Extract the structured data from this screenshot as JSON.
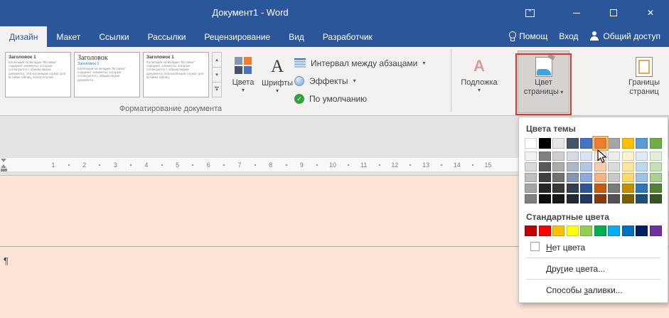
{
  "window": {
    "title": "Документ1 - Word"
  },
  "tabs": {
    "active_index": 0,
    "items": [
      {
        "label": "Дизайн"
      },
      {
        "label": "Макет"
      },
      {
        "label": "Ссылки"
      },
      {
        "label": "Рассылки"
      },
      {
        "label": "Рецензирование"
      },
      {
        "label": "Вид"
      },
      {
        "label": "Разработчик"
      }
    ],
    "help_label": "Помощ",
    "signin_label": "Вход",
    "share_label": "Общий доступ"
  },
  "ribbon": {
    "gallery_cards": [
      {
        "heading": "Заголовок 1",
        "body": "Коллекция на вкладке \"Вставка\" содержит элементы, которые согласуются с общим видом документа. Эти коллекции служат для вставки таблиц, колонтитулов."
      },
      {
        "heading": "Заголовок",
        "subheading": "Заголовок 1",
        "body": "Коллекция на вкладке \"Вставка\" содержит элементы, которые согласуются с общим видом документа."
      },
      {
        "heading": "Заголовок 1",
        "body": "Коллекция на вкладке \"Вставка\" содержит элементы, которые согласуются с общим видом документа. Эти коллекции служат для вставки таблиц."
      }
    ],
    "colors_label": "Цвета",
    "fonts_label": "Шрифты",
    "paragraph_spacing_label": "Интервал между абзацами",
    "effects_label": "Эффекты",
    "set_default_label": "По умолчанию",
    "group_label": "Форматирование документа",
    "watermark_label": "Подложка",
    "page_color_label_1": "Цвет",
    "page_color_label_2": "страницы",
    "page_borders_label_1": "Границы",
    "page_borders_label_2": "страниц"
  },
  "menu": {
    "title": "Цвета темы",
    "standard_title": "Стандартные цвета",
    "no_color": {
      "pre": "",
      "key": "Н",
      "post": "ет цвета"
    },
    "more_colors": {
      "pre": "Дру",
      "key": "г",
      "post": "ие цвета..."
    },
    "fill_effects": {
      "pre": "Способы ",
      "key": "з",
      "post": "аливки..."
    },
    "hover_index": 5,
    "theme_colors": [
      "#FFFFFF",
      "#000000",
      "#E7E6E6",
      "#44546A",
      "#4472C4",
      "#ED7D31",
      "#A5A5A5",
      "#FFC000",
      "#5B9BD5",
      "#70AD47"
    ],
    "theme_shades": [
      [
        "#F2F2F2",
        "#D9D9D9",
        "#BFBFBF",
        "#A6A6A6",
        "#808080"
      ],
      [
        "#808080",
        "#595959",
        "#404040",
        "#262626",
        "#0D0D0D"
      ],
      [
        "#D0CECE",
        "#AEABAB",
        "#757171",
        "#3B3838",
        "#181717"
      ],
      [
        "#D6DCE5",
        "#ACB9CA",
        "#8496B0",
        "#333F50",
        "#222A35"
      ],
      [
        "#DAE3F3",
        "#B4C7E7",
        "#8EAADB",
        "#2F5597",
        "#1F3864"
      ],
      [
        "#FBE5D6",
        "#F8CBAD",
        "#F4B183",
        "#C55A11",
        "#843C0C"
      ],
      [
        "#EDEDED",
        "#DBDBDB",
        "#C9C9C9",
        "#7B7B7B",
        "#525252"
      ],
      [
        "#FFF2CC",
        "#FFE599",
        "#FFD966",
        "#BF9000",
        "#7F6000"
      ],
      [
        "#DEEBF7",
        "#BDD7EE",
        "#9DC3E6",
        "#2E75B6",
        "#1F4E79"
      ],
      [
        "#E2EFDA",
        "#C6E0B4",
        "#A9D08E",
        "#548235",
        "#375623"
      ]
    ],
    "standard_colors": [
      "#C00000",
      "#FF0000",
      "#FFC000",
      "#FFFF00",
      "#92D050",
      "#00B050",
      "#00B0F0",
      "#0070C0",
      "#002060",
      "#7030A0"
    ]
  },
  "ruler": {
    "numbers": [
      1,
      2,
      3,
      4,
      5,
      6,
      7,
      8,
      9,
      10,
      11,
      12,
      13,
      14,
      15
    ]
  },
  "document": {
    "pilcrow": "¶"
  },
  "colors": {
    "titlebar": "#2b579a",
    "page": "#fce4d6",
    "annotation": "#cf3a32",
    "hover_outline": "#f0a43c"
  }
}
